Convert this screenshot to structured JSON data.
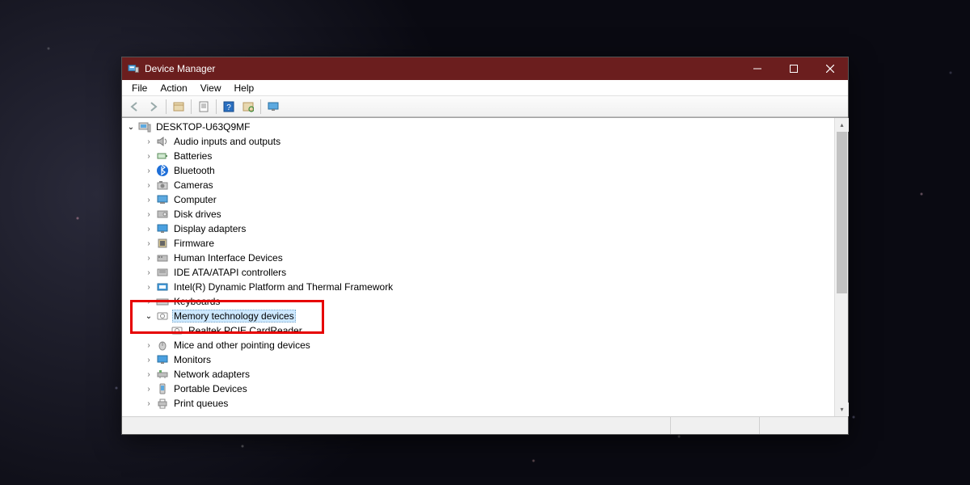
{
  "window": {
    "title": "Device Manager"
  },
  "menubar": {
    "items": [
      "File",
      "Action",
      "View",
      "Help"
    ]
  },
  "tree": {
    "root": "DESKTOP-U63Q9MF",
    "categories": [
      {
        "label": "Audio inputs and outputs",
        "icon": "speaker"
      },
      {
        "label": "Batteries",
        "icon": "battery"
      },
      {
        "label": "Bluetooth",
        "icon": "bluetooth"
      },
      {
        "label": "Cameras",
        "icon": "camera"
      },
      {
        "label": "Computer",
        "icon": "computer"
      },
      {
        "label": "Disk drives",
        "icon": "disk"
      },
      {
        "label": "Display adapters",
        "icon": "display"
      },
      {
        "label": "Firmware",
        "icon": "firmware"
      },
      {
        "label": "Human Interface Devices",
        "icon": "hid"
      },
      {
        "label": "IDE ATA/ATAPI controllers",
        "icon": "ide"
      },
      {
        "label": "Intel(R) Dynamic Platform and Thermal Framework",
        "icon": "intel"
      },
      {
        "label": "Keyboards",
        "icon": "keyboard"
      },
      {
        "label": "Memory technology devices",
        "icon": "memory",
        "expanded": true,
        "selected": true,
        "children": [
          {
            "label": "Realtek PCIE CardReader",
            "icon": "memory"
          }
        ]
      },
      {
        "label": "Mice and other pointing devices",
        "icon": "mouse"
      },
      {
        "label": "Monitors",
        "icon": "monitor"
      },
      {
        "label": "Network adapters",
        "icon": "network"
      },
      {
        "label": "Portable Devices",
        "icon": "portable"
      },
      {
        "label": "Print queues",
        "icon": "printer"
      }
    ]
  }
}
